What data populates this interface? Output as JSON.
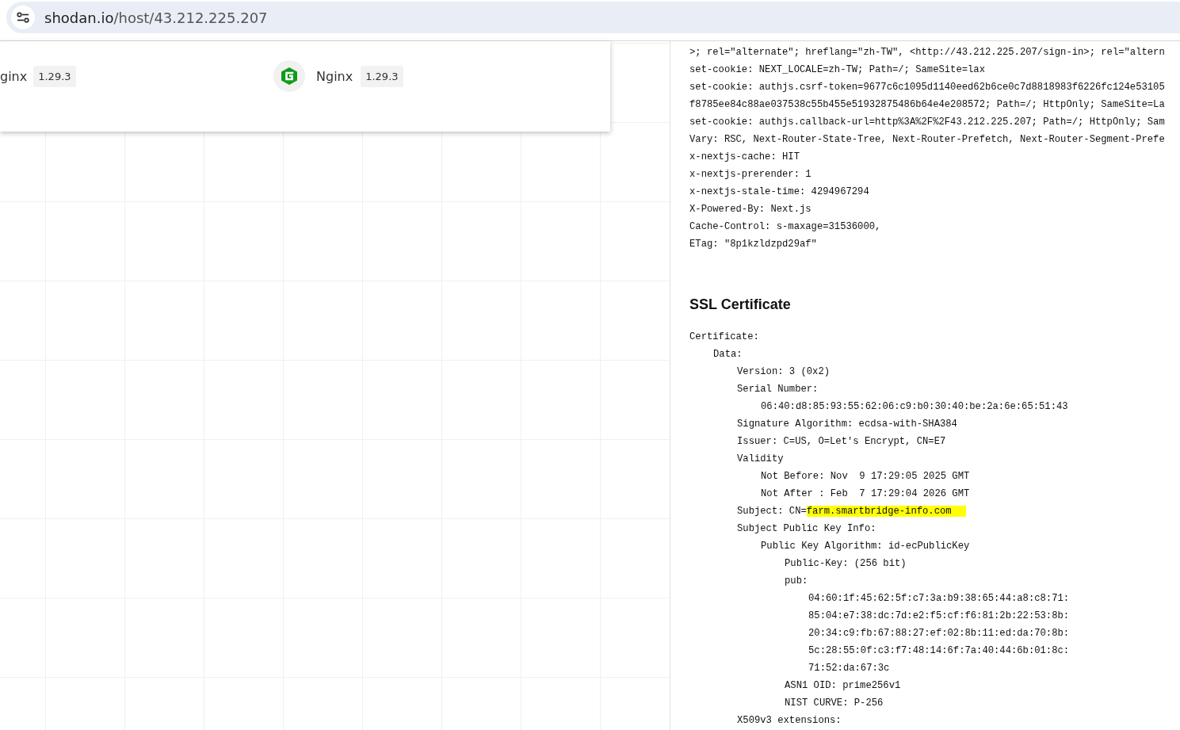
{
  "address_bar": {
    "host": "shodan.io",
    "path": "/host/43.212.225.207"
  },
  "technologies": [
    {
      "name": "ginx",
      "version": "1.29.3",
      "icon": false
    },
    {
      "name": "Nginx",
      "version": "1.29.3",
      "icon": true
    }
  ],
  "http_headers": [
    ">; rel=\"alternate\"; hreflang=\"zh-TW\", <http://43.212.225.207/sign-in>; rel=\"altern",
    "set-cookie: NEXT_LOCALE=zh-TW; Path=/; SameSite=lax",
    "set-cookie: authjs.csrf-token=9677c6c1095d1140eed62b6ce0c7d8818983f6226fc124e53105",
    "f8785ee84c88ae037538c55b455e51932875486b64e4e208572; Path=/; HttpOnly; SameSite=La",
    "set-cookie: authjs.callback-url=http%3A%2F%2F43.212.225.207; Path=/; HttpOnly; Sam",
    "Vary: RSC, Next-Router-State-Tree, Next-Router-Prefetch, Next-Router-Segment-Prefe",
    "x-nextjs-cache: HIT",
    "x-nextjs-prerender: 1",
    "x-nextjs-stale-time: 4294967294",
    "X-Powered-By: Next.js",
    "Cache-Control: s-maxage=31536000,",
    "ETag: \"8p1kzldzpd29af\""
  ],
  "ssl": {
    "title": "SSL Certificate",
    "lines": [
      {
        "text": "Certificate:",
        "children": [
          {
            "text": "Data:",
            "children": [
              {
                "text": "Version: 3 (0x2)"
              },
              {
                "text": "Serial Number:",
                "children": [
                  {
                    "text": "06:40:d8:85:93:55:62:06:c9:b0:30:40:be:2a:6e:65:51:43"
                  }
                ]
              },
              {
                "text": "Signature Algorithm: ecdsa-with-SHA384"
              },
              {
                "text": "Issuer: C=US, O=Let's Encrypt, CN=E7"
              },
              {
                "text": "Validity",
                "children": [
                  {
                    "text": "Not Before: Nov  9 17:29:05 2025 GMT"
                  },
                  {
                    "text": "Not After : Feb  7 17:29:04 2026 GMT"
                  }
                ]
              },
              {
                "text": "Subject: CN=",
                "highlight": "farm.smartbridge-info.com"
              },
              {
                "text": "Subject Public Key Info:",
                "children": [
                  {
                    "text": "Public Key Algorithm: id-ecPublicKey",
                    "children": [
                      {
                        "text": "Public-Key: (256 bit)"
                      },
                      {
                        "text": "pub:",
                        "children": [
                          {
                            "text": "04:60:1f:45:62:5f:c7:3a:b9:38:65:44:a8:c8:71:"
                          },
                          {
                            "text": "85:04:e7:38:dc:7d:e2:f5:cf:f6:81:2b:22:53:8b:"
                          },
                          {
                            "text": "20:34:c9:fb:67:88:27:ef:02:8b:11:ed:da:70:8b:"
                          },
                          {
                            "text": "5c:28:55:0f:c3:f7:48:14:6f:7a:40:44:6b:01:8c:"
                          },
                          {
                            "text": "71:52:da:67:3c"
                          }
                        ]
                      },
                      {
                        "text": "ASN1 OID: prime256v1"
                      },
                      {
                        "text": "NIST CURVE: P-256"
                      }
                    ]
                  }
                ]
              },
              {
                "text": "X509v3 extensions:"
              }
            ]
          }
        ]
      }
    ]
  }
}
